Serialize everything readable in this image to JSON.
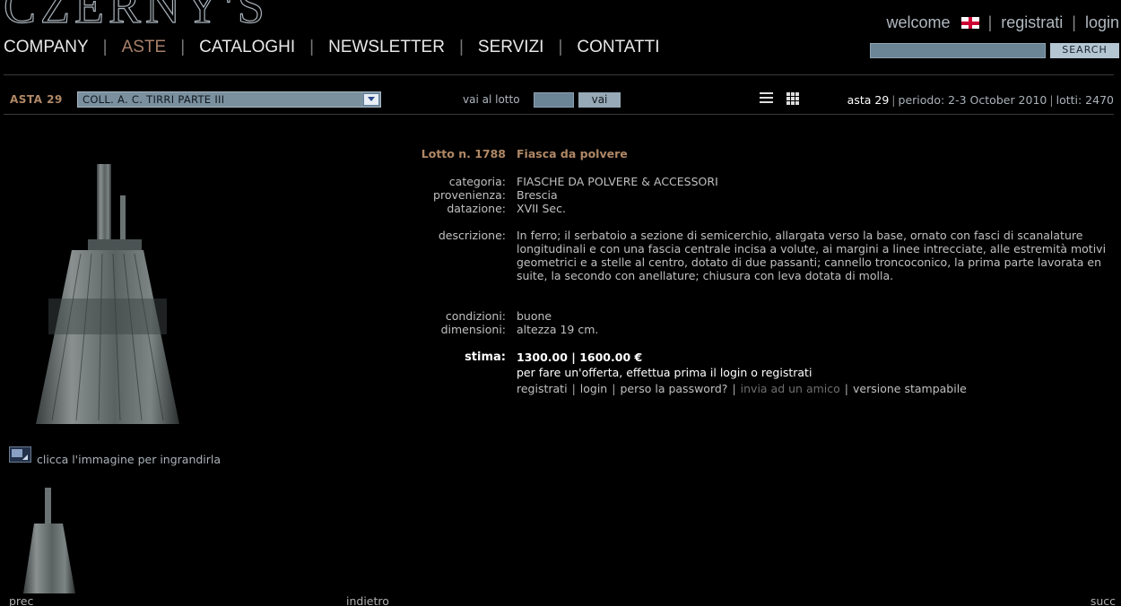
{
  "logo": "CZERNY'S",
  "nav": {
    "company": "COMPANY",
    "aste": "ASTE",
    "cataloghi": "CATALOGHI",
    "newsletter": "NEWSLETTER",
    "servizi": "SERVIZI",
    "contatti": "CONTATTI"
  },
  "user": {
    "welcome": "welcome",
    "register": "registrati",
    "login": "login"
  },
  "search": {
    "button": "SEARCH",
    "value": ""
  },
  "toolbar": {
    "asta_label": "ASTA 29",
    "selected_catalog": "COLL. A. C. TIRRI PARTE III",
    "goto_label": "vai al lotto",
    "goto_value": "",
    "goto_button": "vai",
    "asta_name": "asta 29",
    "period": "periodo: 2-3 October 2010",
    "lots": "lotti: 2470"
  },
  "lot": {
    "number_label": "Lotto n. 1788",
    "title": "Fiasca da polvere",
    "categoria_label": "categoria:",
    "categoria": "FIASCHE DA POLVERE & ACCESSORI",
    "provenienza_label": "provenienza:",
    "provenienza": "Brescia",
    "datazione_label": "datazione:",
    "datazione": "XVII Sec.",
    "descrizione_label": "descrizione:",
    "descrizione": "In ferro; il serbatoio a sezione di semicerchio, allargata verso la base, ornato con fasci di scanalature longitudinali e con una fascia centrale incisa a volute, ai margini a linee intrecciate, alle estremità motivi geometrici e a stelle al centro, dotato di due passanti; cannello troncoconico, la prima parte lavorata en suite, la secondo con anellature; chiusura con leva dotata di molla.",
    "condizioni_label": "condizioni:",
    "condizioni": "buone",
    "dimensioni_label": "dimensioni:",
    "dimensioni": "altezza 19 cm.",
    "stima_label": "stima:",
    "stima": "1300.00 | 1600.00 €",
    "offer_text": "per fare un'offerta, effettua prima il login o registrati"
  },
  "actions": {
    "registrati": "registrati",
    "login": "login",
    "password": "perso la password?",
    "invia": "invia ad un amico",
    "stampabile": "versione stampabile"
  },
  "image": {
    "enlarge_text": "clicca l'immagine per ingrandirla"
  },
  "pager": {
    "prev": "prec",
    "back": "indietro",
    "next": "succ"
  }
}
